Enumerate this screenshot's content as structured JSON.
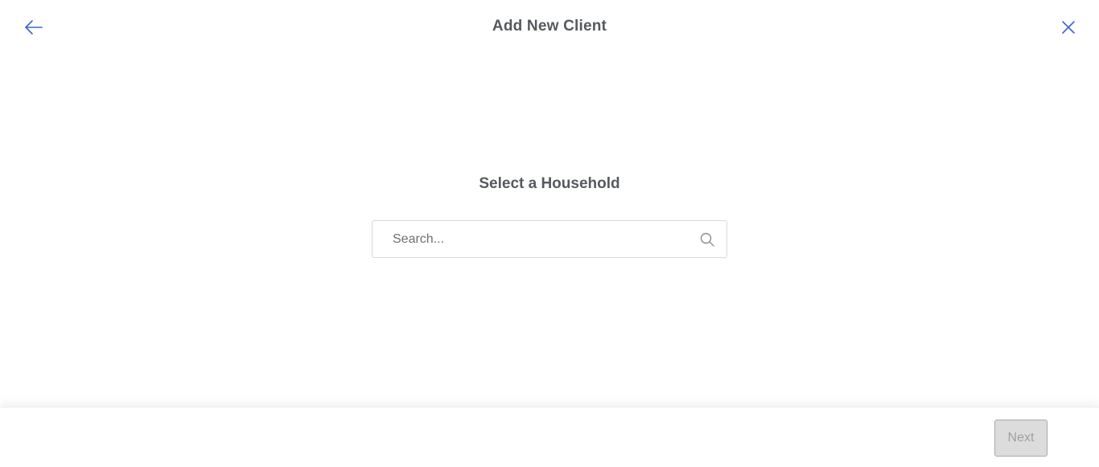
{
  "header": {
    "title": "Add New Client",
    "back_icon": "arrow-left-icon",
    "close_icon": "close-icon"
  },
  "main": {
    "section_title": "Select a Household",
    "search": {
      "placeholder": "Search...",
      "value": "",
      "icon": "search-icon"
    }
  },
  "footer": {
    "next_label": "Next",
    "next_disabled": true
  },
  "colors": {
    "accent": "#3d63c8",
    "title_text": "#555a60",
    "disabled_bg": "#dcdcdc",
    "disabled_text": "#a0a0a0"
  }
}
